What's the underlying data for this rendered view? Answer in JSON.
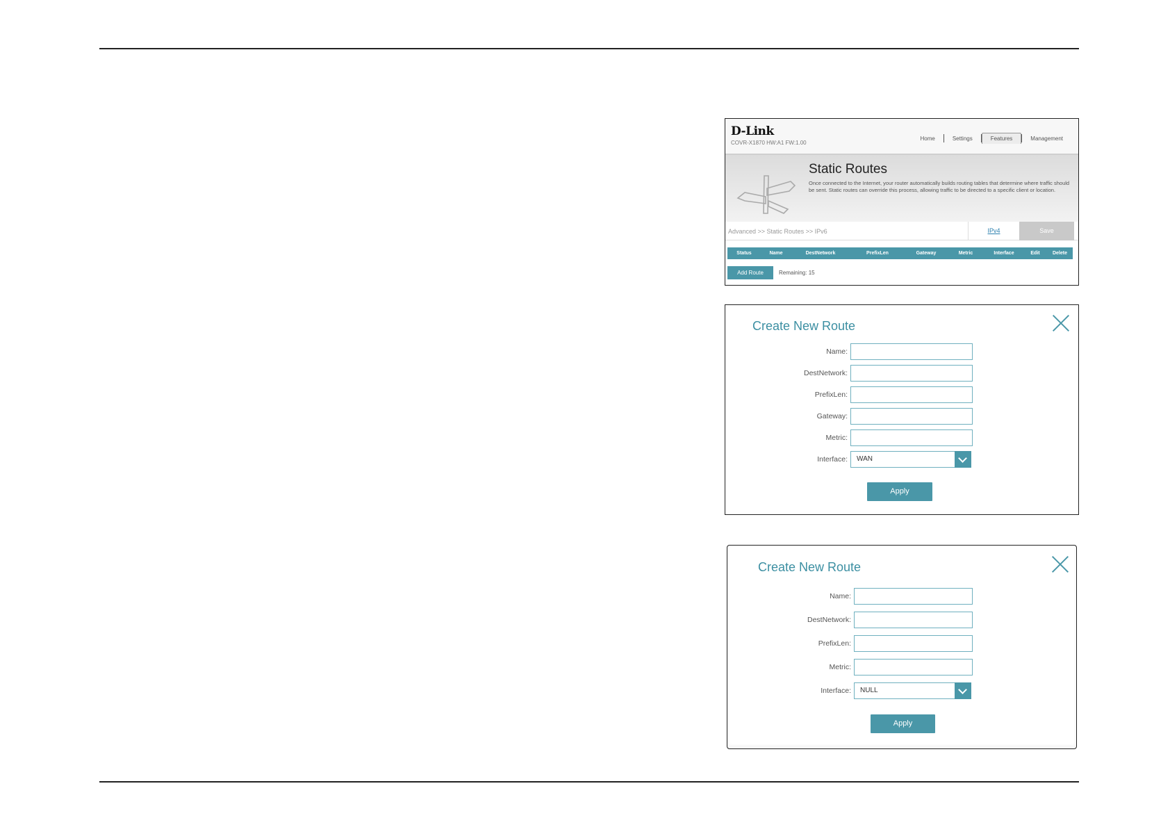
{
  "router_page": {
    "logo": "D-Link",
    "model": "COVR-X1870 HW:A1 FW:1.00",
    "nav": [
      "Home",
      "Settings",
      "Features",
      "Management"
    ],
    "active_nav": "Features",
    "title": "Static Routes",
    "description": "Once connected to the Internet, your router automatically builds routing tables that determine where traffic should be sent. Static routes can override this process, allowing traffic to be directed to a specific client or location.",
    "breadcrumb": "Advanced >> Static Routes >> IPv6",
    "ipv4_link": "IPv4",
    "save_label": "Save",
    "columns": [
      "Status",
      "Name",
      "DestNetwork",
      "PrefixLen",
      "Gateway",
      "Metric",
      "Interface",
      "Edit",
      "Delete"
    ],
    "add_route_label": "Add Route",
    "remaining": "Remaining: 15"
  },
  "dialog_wan": {
    "title": "Create New Route",
    "labels": {
      "name": "Name:",
      "dest": "DestNetwork:",
      "prefix": "PrefixLen:",
      "gateway": "Gateway:",
      "metric": "Metric:",
      "interface": "Interface:"
    },
    "interface_value": "WAN",
    "apply_label": "Apply"
  },
  "dialog_null": {
    "title": "Create New Route",
    "labels": {
      "name": "Name:",
      "dest": "DestNetwork:",
      "prefix": "PrefixLen:",
      "metric": "Metric:",
      "interface": "Interface:"
    },
    "interface_value": "NULL",
    "apply_label": "Apply"
  },
  "colors": {
    "accent": "#4a97a8",
    "title_teal": "#3c8fa2",
    "input_border": "#6fb0bf",
    "save_disabled": "#c9c9c9"
  },
  "icons": [
    "signpost-icon",
    "close-icon",
    "chevron-down-icon"
  ]
}
